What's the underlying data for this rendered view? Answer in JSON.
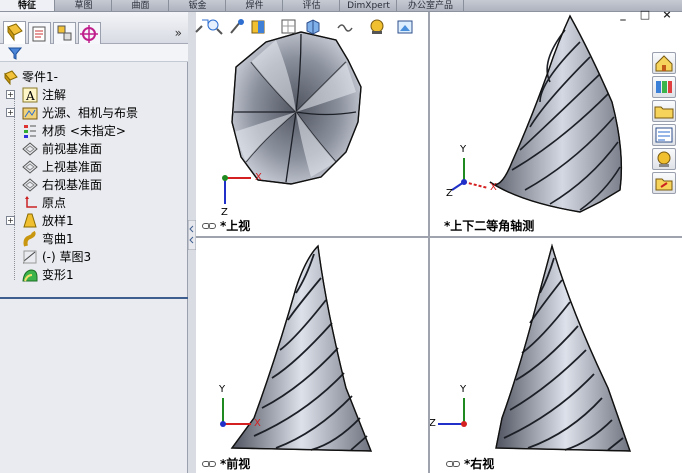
{
  "ribbon": {
    "tabs": [
      {
        "label": "特征",
        "active": true
      },
      {
        "label": "草图",
        "active": false
      },
      {
        "label": "曲面",
        "active": false
      },
      {
        "label": "钣金",
        "active": false
      },
      {
        "label": "焊件",
        "active": false
      },
      {
        "label": "评估",
        "active": false
      },
      {
        "label": "DimXpert",
        "active": false
      },
      {
        "label": "办公室产品",
        "active": false
      }
    ]
  },
  "feature_tree": {
    "more_glyph": "»",
    "items": [
      {
        "label": "零件1-",
        "icon": "part-icon",
        "expander": ""
      },
      {
        "label": "注解",
        "icon": "annotations-icon",
        "expander": "+"
      },
      {
        "label": "光源、相机与布景",
        "icon": "lights-cameras-icon",
        "expander": "+"
      },
      {
        "label": "材质 <未指定>",
        "icon": "material-icon",
        "expander": ""
      },
      {
        "label": "前视基准面",
        "icon": "plane-icon",
        "expander": ""
      },
      {
        "label": "上视基准面",
        "icon": "plane-icon",
        "expander": ""
      },
      {
        "label": "右视基准面",
        "icon": "plane-icon",
        "expander": ""
      },
      {
        "label": "原点",
        "icon": "origin-icon",
        "expander": ""
      },
      {
        "label": "放样1",
        "icon": "loft-icon",
        "expander": "+"
      },
      {
        "label": "弯曲1",
        "icon": "flex-icon",
        "expander": ""
      },
      {
        "label": "(-) 草图3",
        "icon": "sketch-icon",
        "expander": ""
      },
      {
        "label": "变形1",
        "icon": "deform-icon",
        "expander": ""
      }
    ]
  },
  "viewports": {
    "top_left": {
      "label": "*上视"
    },
    "top_right": {
      "label": "*上下二等角轴测"
    },
    "bottom_left": {
      "label": "*前视"
    },
    "bottom_right": {
      "label": "*右视"
    }
  },
  "triad": {
    "x": "X",
    "y": "Y",
    "z": "Z"
  },
  "window_buttons": {
    "minimize": "_",
    "restore": "□",
    "close": "×"
  },
  "colors": {
    "accent": "#3f5e90",
    "axis_x": "#d42020",
    "axis_y": "#1f8a1f",
    "axis_z": "#2030c8"
  }
}
